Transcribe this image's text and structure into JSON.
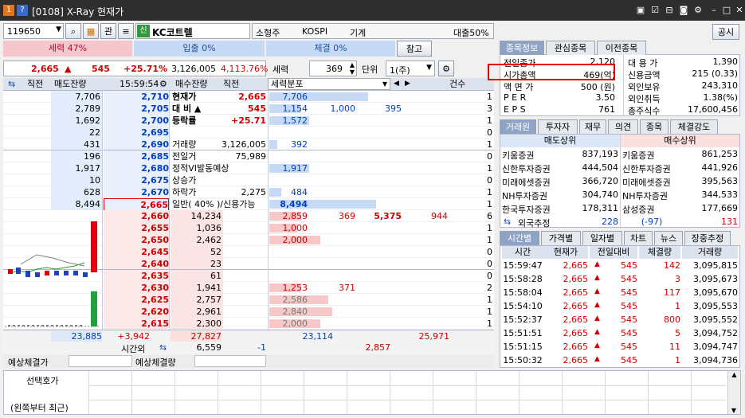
{
  "window": {
    "title": "[0108] X-Ray 현재가",
    "icon1": "1",
    "icon2": "?"
  },
  "toolbar": {
    "code": "119650",
    "btn_gwan": "관",
    "sin_badge": "신",
    "stock_name": "KC코트렐",
    "type": "소형주",
    "market": "KOSPI",
    "sector": "기계",
    "loan": "대출50%",
    "gongsi": "공시"
  },
  "strength": {
    "sell": "세력 47%",
    "buy": "입출 0%",
    "exec": "체결 0%",
    "ref": "참고"
  },
  "price_line": {
    "price": "2,665",
    "arrow": "▲",
    "change": "545",
    "rate": "+25.71%",
    "volume": "3,126,005",
    "pct": "4,113.76%"
  },
  "ctrl2": {
    "label": "세력",
    "count": "369",
    "unit_label": "단위",
    "unit": "1(주)"
  },
  "ob_header": {
    "c1": "직전",
    "c2": "매도잔량",
    "time": "15:59:54",
    "c3": "매수잔량",
    "c4": "직전",
    "c5": "세력분포",
    "c6": "건수"
  },
  "asks": [
    {
      "qty": "7,706",
      "price": "2,710",
      "dist": "7,706",
      "d2": "",
      "d3": "",
      "cnt": "1",
      "bar": 0.25
    },
    {
      "qty": "2,789",
      "price": "2,705",
      "dist": "1,154",
      "d2": "1,000",
      "d3": "395",
      "cnt": "3",
      "bar": 0.08
    },
    {
      "qty": "1,692",
      "price": "2,700",
      "dist": "1,572",
      "d2": "",
      "d3": "",
      "cnt": "1",
      "bar": 0.1
    },
    {
      "qty": "22",
      "price": "2,695",
      "dist": "",
      "d2": "",
      "d3": "",
      "cnt": "0",
      "bar": 0
    },
    {
      "qty": "431",
      "price": "2,690",
      "dist": "392",
      "d2": "",
      "d3": "",
      "cnt": "1",
      "bar": 0.02
    },
    {
      "qty": "196",
      "price": "2,685",
      "dist": "",
      "d2": "",
      "d3": "",
      "cnt": "0",
      "bar": 0
    },
    {
      "qty": "1,917",
      "price": "2,680",
      "dist": "1,917",
      "d2": "",
      "d3": "",
      "cnt": "1",
      "bar": 0.1
    },
    {
      "qty": "10",
      "price": "2,675",
      "dist": "",
      "d2": "",
      "d3": "",
      "cnt": "0",
      "bar": 0
    },
    {
      "qty": "628",
      "price": "2,670",
      "dist": "484",
      "d2": "",
      "d3": "",
      "cnt": "1",
      "bar": 0.03
    },
    {
      "qty": "8,494",
      "price": "2,665",
      "dist": "8,494",
      "d2": "",
      "d3": "",
      "cnt": "1",
      "bar": 0.27
    }
  ],
  "info": [
    {
      "k": "현재가",
      "v": "2,665",
      "cls": "red",
      "bold": true
    },
    {
      "k": "대 비 ▲",
      "v": "545",
      "cls": "red",
      "bold": true
    },
    {
      "k": "등락률",
      "v": "+25.71",
      "cls": "red",
      "bold": true
    },
    {
      "k": "",
      "v": "",
      "cls": "",
      "bold": false
    },
    {
      "k": "거래량",
      "v": "3,126,005",
      "cls": "",
      "bold": false
    },
    {
      "k": "전일거",
      "v": "75,989",
      "cls": "",
      "bold": false
    },
    {
      "k": "정적VI발동예상",
      "v": "",
      "cls": "",
      "bold": false
    },
    {
      "k": "상승가",
      "v": "",
      "cls": "",
      "bold": false
    },
    {
      "k": "하락가",
      "v": "2,275",
      "cls": "",
      "bold": false
    },
    {
      "k": "일반( 40% )/신용가능",
      "v": "",
      "cls": "",
      "bold": false
    }
  ],
  "bids": [
    {
      "price": "2,660",
      "qty": "14,234",
      "dist": "2,859",
      "d2": "369",
      "d3": "5,375",
      "d4": "944",
      "cnt": "6",
      "bar": 0.08
    },
    {
      "price": "2,655",
      "qty": "1,036",
      "dist": "1,000",
      "d2": "",
      "d3": "",
      "d4": "",
      "cnt": "1",
      "bar": 0.07
    },
    {
      "price": "2,650",
      "qty": "2,462",
      "dist": "2,000",
      "d2": "",
      "d3": "",
      "d4": "",
      "cnt": "1",
      "bar": 0.13
    },
    {
      "price": "2,645",
      "qty": "52",
      "dist": "",
      "d2": "",
      "d3": "",
      "d4": "",
      "cnt": "0",
      "bar": 0
    },
    {
      "price": "2,640",
      "qty": "23",
      "dist": "",
      "d2": "",
      "d3": "",
      "d4": "",
      "cnt": "0",
      "bar": 0
    },
    {
      "price": "2,635",
      "qty": "61",
      "dist": "",
      "d2": "",
      "d3": "",
      "d4": "",
      "cnt": "0",
      "bar": 0
    },
    {
      "price": "2,630",
      "qty": "1,941",
      "dist": "1,253",
      "d2": "371",
      "d3": "",
      "d4": "",
      "cnt": "2",
      "bar": 0.08
    },
    {
      "price": "2,625",
      "qty": "2,757",
      "dist": "2,586",
      "d2": "",
      "d3": "",
      "d4": "",
      "cnt": "1",
      "bar": 0.15
    },
    {
      "price": "2,620",
      "qty": "2,961",
      "dist": "2,840",
      "d2": "",
      "d3": "",
      "d4": "",
      "cnt": "1",
      "bar": 0.16
    },
    {
      "price": "2,615",
      "qty": "2,300",
      "dist": "2,000",
      "d2": "",
      "d3": "",
      "d4": "",
      "cnt": "1",
      "bar": 0.13
    }
  ],
  "totals": {
    "ask_total": "23,885",
    "diff": "+3,942",
    "bid_total": "27,827",
    "dist_ask": "23,114",
    "dist_bid": "25,971",
    "after_label": "시간외",
    "after_val": "6,559",
    "after_diff": "-1",
    "dist_after": "2,857"
  },
  "expected": {
    "price_label": "예상체결가",
    "qty_label": "예상체결량",
    "select_label": "선택호가",
    "recent_label": "(왼쪽부터 최근)"
  },
  "right_tabs": [
    "종목정보",
    "관심종목",
    "이전종목"
  ],
  "stock_info": [
    {
      "k": "전일종가",
      "v": "2,120",
      "k2": "대 용 가",
      "v2": "1,390"
    },
    {
      "k": "시가총액",
      "v": "469(억)",
      "k2": "신용금액",
      "v2": "215 (0.33)"
    },
    {
      "k": "액 면 가",
      "v": "500 (원)",
      "k2": "외인보유",
      "v2": "243,310"
    },
    {
      "k": "P E R",
      "v": "3.50",
      "k2": "외인취득",
      "v2": "1.38(%)"
    },
    {
      "k": "E P S",
      "v": "761",
      "k2": "총주식수",
      "v2": "17,600,456"
    }
  ],
  "broker_tabs": [
    "거래원",
    "투자자",
    "재무",
    "의견",
    "종목",
    "체결강도"
  ],
  "broker_hdr": {
    "sell": "매도상위",
    "buy": "매수상위"
  },
  "brokers": [
    {
      "s": "키움증권",
      "sq": "837,193",
      "b": "키움증권",
      "bq": "861,253"
    },
    {
      "s": "신한투자증권",
      "sq": "444,504",
      "b": "신한투자증권",
      "bq": "441,926"
    },
    {
      "s": "미래에셋증권",
      "sq": "366,720",
      "b": "미래에셋증권",
      "bq": "395,563"
    },
    {
      "s": "NH투자증권",
      "sq": "304,740",
      "b": "NH투자증권",
      "bq": "344,533"
    },
    {
      "s": "한국투자증권",
      "sq": "178,311",
      "b": "삼성증권",
      "bq": "177,669"
    }
  ],
  "foreign": {
    "label": "외국추정",
    "sell": "228",
    "diff": "(-97)",
    "buy": "131"
  },
  "time_tabs": [
    "시간별",
    "가격별",
    "일자별",
    "차트",
    "뉴스",
    "장중추정"
  ],
  "ticks_hdr": [
    "시간",
    "현재가",
    "전일대비",
    "체결량",
    "거래량"
  ],
  "ticks": [
    {
      "t": "15:59:47",
      "p": "2,665",
      "d": "545",
      "q": "142",
      "v": "3,095,815"
    },
    {
      "t": "15:58:28",
      "p": "2,665",
      "d": "545",
      "q": "3",
      "v": "3,095,673"
    },
    {
      "t": "15:58:04",
      "p": "2,665",
      "d": "545",
      "q": "117",
      "v": "3,095,670"
    },
    {
      "t": "15:54:10",
      "p": "2,665",
      "d": "545",
      "q": "1",
      "v": "3,095,553"
    },
    {
      "t": "15:52:37",
      "p": "2,665",
      "d": "545",
      "q": "800",
      "v": "3,095,552"
    },
    {
      "t": "15:51:51",
      "p": "2,665",
      "d": "545",
      "q": "5",
      "v": "3,094,752"
    },
    {
      "t": "15:51:15",
      "p": "2,665",
      "d": "545",
      "q": "11",
      "v": "3,094,747"
    },
    {
      "t": "15:50:32",
      "p": "2,665",
      "d": "545",
      "q": "1",
      "v": "3,094,736"
    }
  ]
}
